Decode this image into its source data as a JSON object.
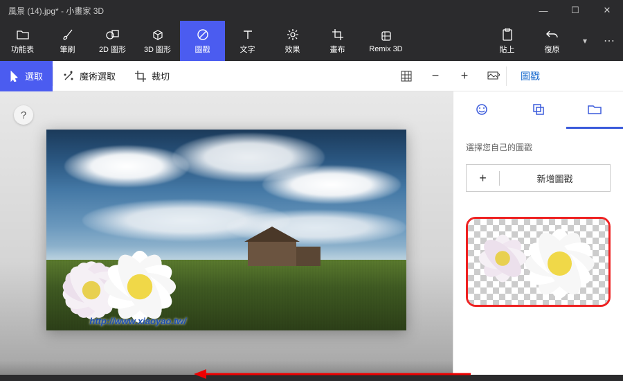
{
  "title": "風景 (14).jpg* - 小畫家 3D",
  "window": {
    "min": "—",
    "max": "☐",
    "close": "✕"
  },
  "ribbon": [
    {
      "id": "menu",
      "label": "功能表",
      "icon": "folder"
    },
    {
      "id": "brush",
      "label": "筆刷",
      "icon": "brush"
    },
    {
      "id": "shape2d",
      "label": "2D 圖形",
      "icon": "shape2d"
    },
    {
      "id": "shape3d",
      "label": "3D 圖形",
      "icon": "cube"
    },
    {
      "id": "sticker",
      "label": "圖戳",
      "icon": "sticker",
      "active": true
    },
    {
      "id": "text",
      "label": "文字",
      "icon": "text"
    },
    {
      "id": "effects",
      "label": "效果",
      "icon": "sun"
    },
    {
      "id": "canvas",
      "label": "畫布",
      "icon": "crop"
    },
    {
      "id": "remix",
      "label": "Remix 3D",
      "icon": "remix"
    },
    {
      "id": "paste",
      "label": "貼上",
      "icon": "paste"
    },
    {
      "id": "undo",
      "label": "復原",
      "icon": "undo"
    }
  ],
  "toolbar": {
    "select": "選取",
    "magic": "魔術選取",
    "crop": "裁切",
    "panel_title": "圖戳"
  },
  "sidebar": {
    "label": "選擇您自己的圖戳",
    "add": "新增圖戳",
    "plus": "+"
  },
  "help": "?",
  "watermark": "http://www.xiaoyao.tw/"
}
